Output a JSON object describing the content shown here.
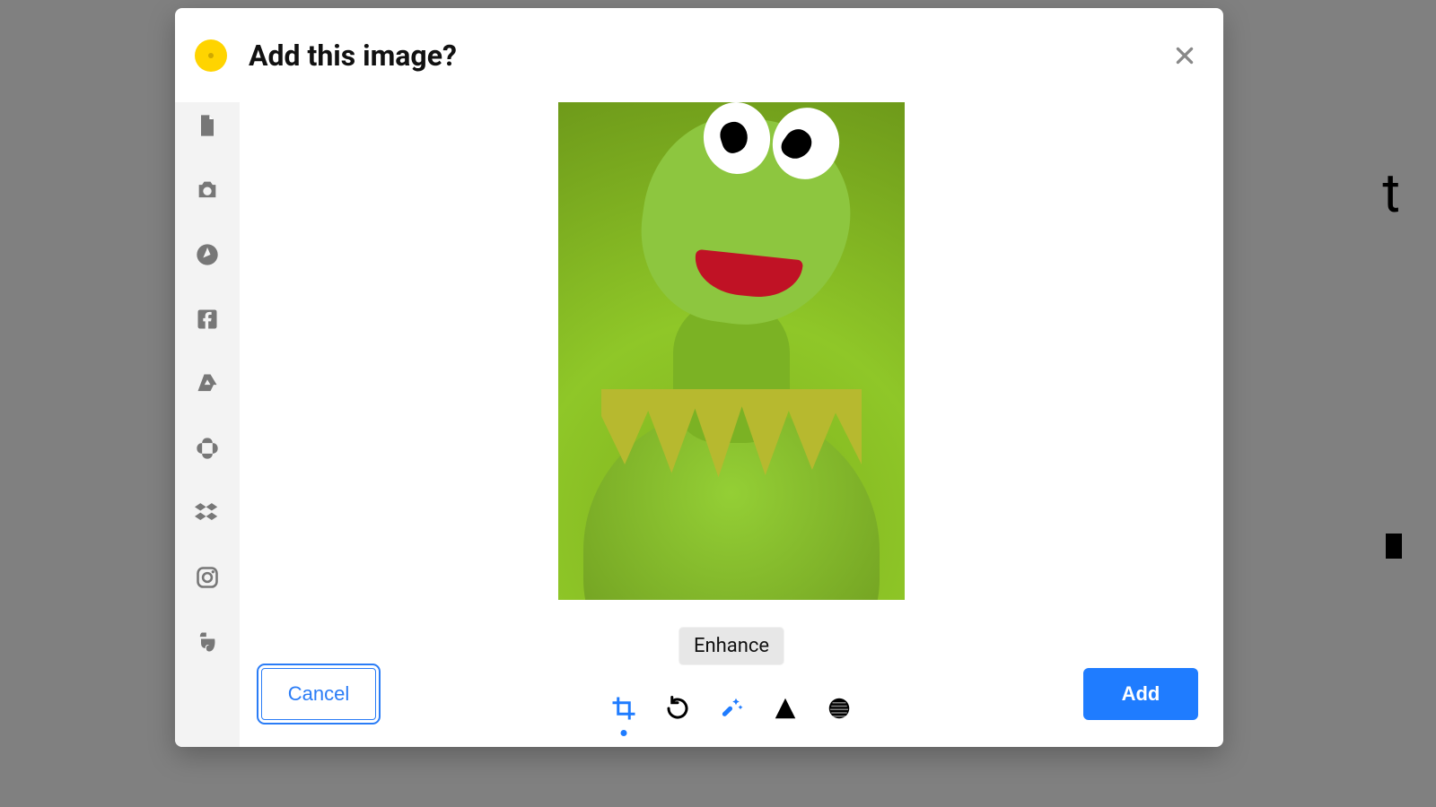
{
  "modal": {
    "title": "Add this image?",
    "close_name": "close-icon"
  },
  "sidebar": {
    "items": [
      {
        "name": "file-icon"
      },
      {
        "name": "camera-icon"
      },
      {
        "name": "compass-icon"
      },
      {
        "name": "facebook-icon"
      },
      {
        "name": "google-drive-icon"
      },
      {
        "name": "google-photos-icon"
      },
      {
        "name": "dropbox-icon"
      },
      {
        "name": "instagram-icon"
      },
      {
        "name": "evernote-icon"
      }
    ]
  },
  "preview": {
    "description": "green frog puppet on white background"
  },
  "tools": {
    "items": [
      {
        "name": "crop-icon",
        "label": "Crop",
        "active": true
      },
      {
        "name": "rotate-icon",
        "label": "Rotate",
        "active": false
      },
      {
        "name": "enhance-icon",
        "label": "Enhance",
        "active": false,
        "hovered": true
      },
      {
        "name": "sharpen-icon",
        "label": "Sharpen",
        "active": false
      },
      {
        "name": "blur-icon",
        "label": "Blur",
        "active": false
      }
    ],
    "tooltip": "Enhance"
  },
  "buttons": {
    "cancel": "Cancel",
    "add": "Add"
  },
  "colors": {
    "accent_yellow": "#FFD400",
    "primary_blue": "#1F7CFF",
    "sidebar_bg": "#F3F3F3"
  }
}
